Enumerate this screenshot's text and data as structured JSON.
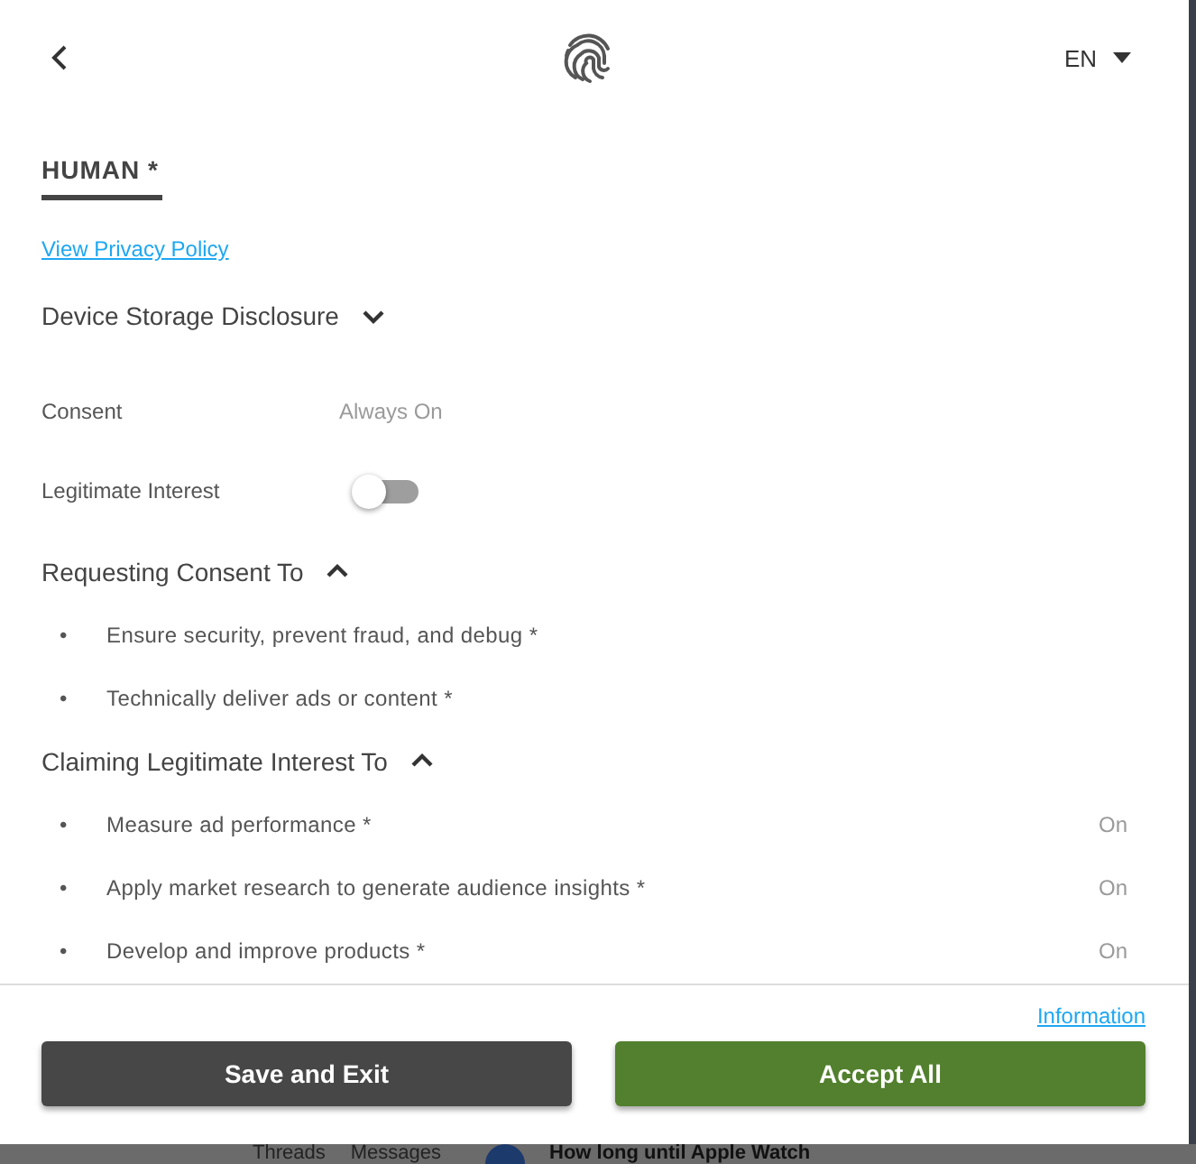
{
  "header": {
    "language": "EN"
  },
  "tabs": [
    {
      "label": "HUMAN *",
      "selected": true
    }
  ],
  "privacy_link": "View Privacy Policy",
  "disclosure": {
    "title": "Device Storage Disclosure",
    "expanded": false
  },
  "settings": [
    {
      "kind": "status",
      "label": "Consent",
      "status": "Always On"
    },
    {
      "kind": "toggle",
      "label": "Legitimate Interest",
      "on": false
    }
  ],
  "purpose_groups": [
    {
      "title": "Requesting Consent To",
      "expanded": true,
      "items": [
        {
          "marker": "•",
          "label": "Ensure security, prevent fraud, and debug *"
        },
        {
          "marker": "•",
          "label": "Technically deliver ads or content *"
        }
      ]
    },
    {
      "title": "Claiming Legitimate Interest To",
      "expanded": true,
      "items": [
        {
          "marker": "•",
          "label": "Measure ad performance *",
          "status": "On"
        },
        {
          "marker": "•",
          "label": "Apply market research to generate audience insights *",
          "status": "On"
        },
        {
          "marker": "•",
          "label": "Develop and improve products *",
          "status": "On"
        }
      ]
    }
  ],
  "footer": {
    "info_link": "Information",
    "buttons": [
      {
        "label": "Save and Exit",
        "kind": "secondary"
      },
      {
        "label": "Accept All",
        "kind": "primary"
      }
    ]
  },
  "background_page": {
    "tabs": [
      "Threads",
      "Messages"
    ],
    "headline": "How long until Apple Watch"
  }
}
